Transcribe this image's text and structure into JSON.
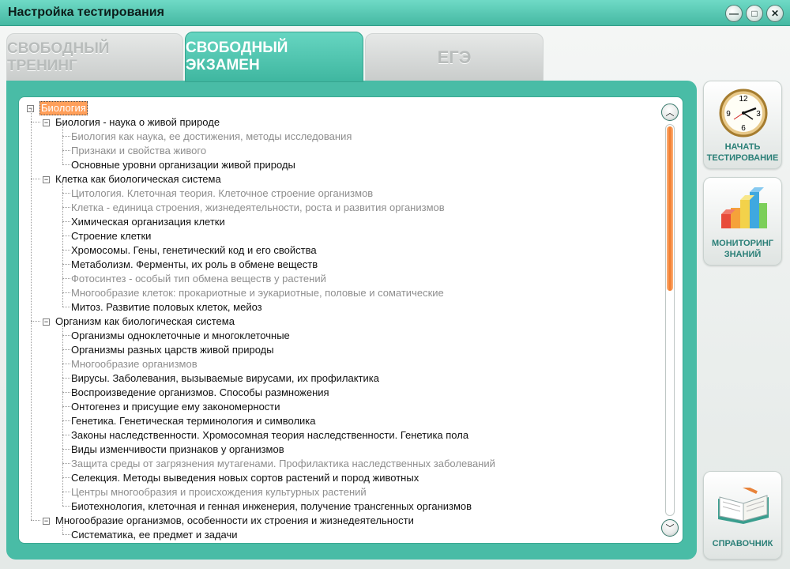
{
  "window": {
    "title": "Настройка тестирования",
    "controls": {
      "minimize": "—",
      "maximize": "□",
      "close": "✕"
    }
  },
  "tabs": [
    {
      "label": "СВОБОДНЫЙ ТРЕНИНГ",
      "active": false
    },
    {
      "label": "СВОБОДНЫЙ ЭКЗАМЕН",
      "active": true
    },
    {
      "label": "ЕГЭ",
      "active": false
    }
  ],
  "tree": {
    "root": "Биология",
    "sections": [
      {
        "label": "Биология - наука о живой природе",
        "items": [
          {
            "label": "Биология как наука, ее достижения, методы исследования",
            "enabled": false
          },
          {
            "label": "Признаки и свойства живого",
            "enabled": false
          },
          {
            "label": "Основные уровни организации живой природы",
            "enabled": true
          }
        ]
      },
      {
        "label": "Клетка как биологическая система",
        "items": [
          {
            "label": "Цитология. Клеточная теория. Клеточное строение организмов",
            "enabled": false
          },
          {
            "label": "Клетка - единица строения, жизнедеятельности, роста и развития организмов",
            "enabled": false
          },
          {
            "label": "Химическая организация клетки",
            "enabled": true
          },
          {
            "label": "Строение клетки",
            "enabled": true
          },
          {
            "label": "Хромосомы. Гены, генетический код и его свойства",
            "enabled": true
          },
          {
            "label": "Метаболизм. Ферменты, их роль в обмене веществ",
            "enabled": true
          },
          {
            "label": "Фотосинтез - особый тип обмена веществ у растений",
            "enabled": false
          },
          {
            "label": "Многообразие клеток: прокариотные и эукариотные, половые и соматические",
            "enabled": false
          },
          {
            "label": "Митоз. Развитие половых клеток, мейоз",
            "enabled": true
          }
        ]
      },
      {
        "label": "Организм как биологическая система",
        "items": [
          {
            "label": "Организмы одноклеточные и многоклеточные",
            "enabled": true
          },
          {
            "label": "Организмы разных царств живой природы",
            "enabled": true
          },
          {
            "label": "Многообразие организмов",
            "enabled": false
          },
          {
            "label": "Вирусы. Заболевания, вызываемые вирусами, их профилактика",
            "enabled": true
          },
          {
            "label": "Воспроизведение организмов. Способы размножения",
            "enabled": true
          },
          {
            "label": "Онтогенез и присущие ему закономерности",
            "enabled": true
          },
          {
            "label": "Генетика. Генетическая терминология и символика",
            "enabled": true
          },
          {
            "label": "Законы наследственности. Хромосомная теория наследственности. Генетика пола",
            "enabled": true
          },
          {
            "label": "Виды изменчивости признаков у организмов",
            "enabled": true
          },
          {
            "label": "Защита среды от загрязнения мутагенами. Профилактика наследственных заболеваний",
            "enabled": false
          },
          {
            "label": "Селекция. Методы выведения новых сортов растений и пород животных",
            "enabled": true
          },
          {
            "label": "Центры многообразия и происхождения культурных растений",
            "enabled": false
          },
          {
            "label": "Биотехнология, клеточная и генная инженерия, получение трансгенных организмов",
            "enabled": true
          }
        ]
      },
      {
        "label": "Многообразие организмов, особенности их строения и  жизнедеятельности",
        "items": [
          {
            "label": "Систематика, ее предмет и задачи",
            "enabled": true
          }
        ]
      }
    ]
  },
  "scrollbar": {
    "up": "︿",
    "down": "﹀"
  },
  "side": {
    "start": {
      "label": "НАЧАТЬ ТЕСТИРОВАНИЕ",
      "icon": "clock-icon",
      "clock_numbers": [
        "12",
        "3",
        "6",
        "9"
      ]
    },
    "monitoring": {
      "label": "МОНИТОРИНГ ЗНАНИЙ",
      "icon": "bar-chart-3d-icon"
    },
    "reference": {
      "label": "СПРАВОЧНИК",
      "icon": "open-book-icon"
    }
  },
  "colors": {
    "accent": "#45b8a2",
    "highlight": "#ff9f5a",
    "label_teal": "#2a7f77"
  }
}
